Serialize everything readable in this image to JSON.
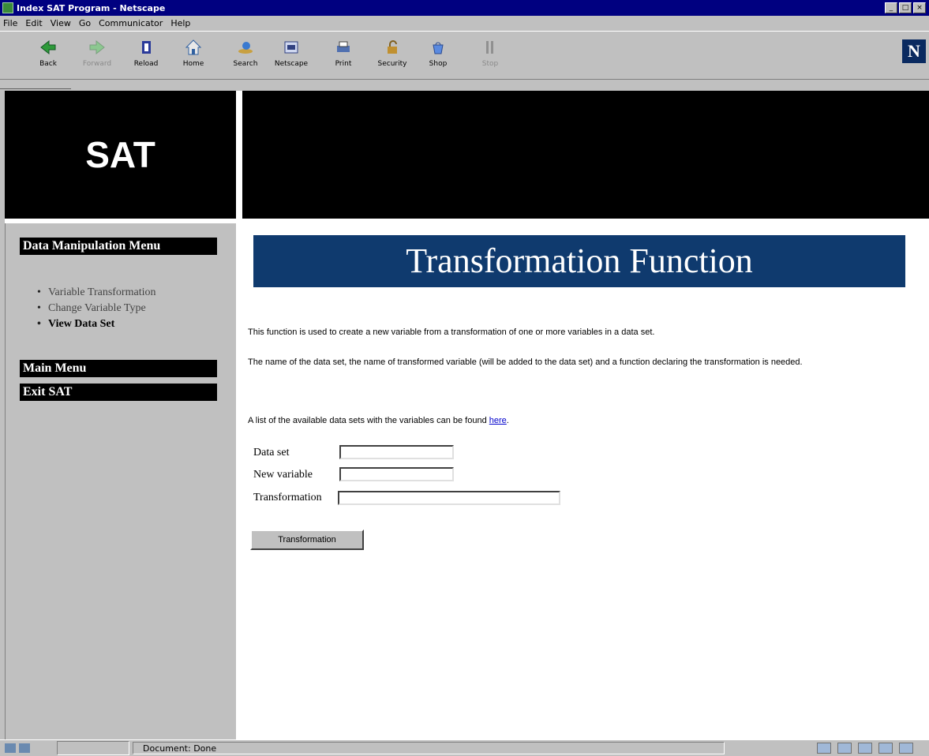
{
  "window": {
    "title": "Index SAT Program - Netscape",
    "controls": [
      "_",
      "□",
      "×"
    ]
  },
  "menu": [
    "File",
    "Edit",
    "View",
    "Go",
    "Communicator",
    "Help"
  ],
  "toolbar": {
    "buttons": [
      {
        "label": "Back",
        "icon": "back-arrow-icon",
        "enabled": true
      },
      {
        "label": "Forward",
        "icon": "forward-arrow-icon",
        "enabled": false
      },
      {
        "label": "Reload",
        "icon": "reload-icon",
        "enabled": true
      },
      {
        "label": "Home",
        "icon": "home-icon",
        "enabled": true
      },
      {
        "label": "Search",
        "icon": "search-icon",
        "enabled": true
      },
      {
        "label": "Netscape",
        "icon": "netscape-icon",
        "enabled": true
      },
      {
        "label": "Print",
        "icon": "print-icon",
        "enabled": true
      },
      {
        "label": "Security",
        "icon": "security-lock-icon",
        "enabled": true
      },
      {
        "label": "Shop",
        "icon": "shop-icon",
        "enabled": true
      },
      {
        "label": "Stop",
        "icon": "stop-icon",
        "enabled": false
      }
    ],
    "logo_letter": "N"
  },
  "header": {
    "logo_text": "SAT"
  },
  "sidebar": {
    "section_title": "Data Manipulation Menu",
    "items": [
      {
        "label": "Variable Transformation",
        "bold": false
      },
      {
        "label": "Change Variable Type",
        "bold": false
      },
      {
        "label": "View Data Set",
        "bold": true
      }
    ],
    "main_menu": "Main Menu",
    "exit": "Exit SAT"
  },
  "main": {
    "banner_title": "Transformation Function",
    "paragraph1": "This function is used to create a new variable from a transformation of one or more variables in a data set.",
    "paragraph2": "The name of the data set, the name of transformed variable (will be added to the data set) and a function declaring the transformation is needed.",
    "paragraph3_prefix": "A list of the available data sets with the variables can be found ",
    "paragraph3_link": "here",
    "paragraph3_suffix": ".",
    "form": {
      "dataset_label": "Data set",
      "dataset_value": "",
      "newvar_label": "New variable",
      "newvar_value": "",
      "transformation_label": "Transformation",
      "transformation_value": "",
      "submit_label": "Transformation"
    }
  },
  "status": {
    "text": "Document: Done"
  },
  "colors": {
    "title_bar": "#000080",
    "banner": "#0f3a6e",
    "link": "#0000cc"
  }
}
